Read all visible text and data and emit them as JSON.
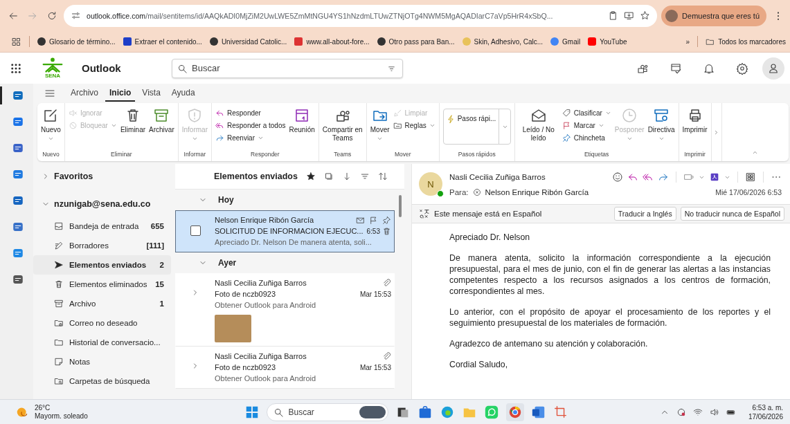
{
  "browser": {
    "url_host": "outlook.office.com",
    "url_path": "/mail/sentitems/id/AAQkADI0MjZiM2UwLWE5ZmMtNGU4YS1hNzdmLTUwZTNjOTg4NWM5MgAQADIarC7aVp5HrR4xSbQ...",
    "profile_chip": "Demuestra que eres tú",
    "bookmarks": [
      {
        "label": "Glosario de término..."
      },
      {
        "label": "Extraer el contenido..."
      },
      {
        "label": "Universidad Catolic..."
      },
      {
        "label": "www.all-about-fore..."
      },
      {
        "label": "Otro pass para Ban..."
      },
      {
        "label": "Skin, Adhesivo, Calc..."
      },
      {
        "label": "Gmail"
      },
      {
        "label": "YouTube"
      }
    ],
    "more": "»",
    "all_bookmarks": "Todos los marcadores"
  },
  "app": {
    "logo_text": "SENA",
    "name": "Outlook",
    "search_placeholder": "Buscar"
  },
  "rail": [
    {
      "selected": true
    },
    {
      "selected": false
    },
    {
      "selected": false
    },
    {
      "selected": false
    },
    {
      "selected": false
    },
    {
      "selected": false
    },
    {
      "selected": false
    },
    {
      "selected": false
    }
  ],
  "menu_tabs": [
    {
      "label": "Archivo",
      "selected": false
    },
    {
      "label": "Inicio",
      "selected": true
    },
    {
      "label": "Vista",
      "selected": false
    },
    {
      "label": "Ayuda",
      "selected": false
    }
  ],
  "ribbon": {
    "groups": [
      {
        "label": "Nuevo",
        "items": [
          {
            "kind": "large",
            "label": "Nuevo",
            "disabled": false,
            "dropdown": true
          }
        ]
      },
      {
        "label": "Eliminar",
        "items": [
          {
            "kind": "stack",
            "items": [
              {
                "label": "Ignorar",
                "disabled": true,
                "dropdown": false
              },
              {
                "label": "Bloquear",
                "disabled": true,
                "dropdown": true
              }
            ]
          },
          {
            "kind": "large",
            "label": "Eliminar",
            "disabled": false,
            "dropdown": false
          },
          {
            "kind": "large",
            "label": "Archivar",
            "disabled": false,
            "dropdown": false
          }
        ]
      },
      {
        "label": "Informar",
        "items": [
          {
            "kind": "large",
            "label": "Informar",
            "disabled": true,
            "dropdown": true
          }
        ]
      },
      {
        "label": "Responder",
        "items": [
          {
            "kind": "stack",
            "items": [
              {
                "label": "Responder",
                "disabled": false,
                "dropdown": false
              },
              {
                "label": "Responder a todos",
                "disabled": false,
                "dropdown": false
              },
              {
                "label": "Reenviar",
                "disabled": false,
                "dropdown": true
              }
            ]
          },
          {
            "kind": "large",
            "label": "Reunión",
            "disabled": false,
            "dropdown": false
          }
        ]
      },
      {
        "label": "Teams",
        "items": [
          {
            "kind": "large",
            "label": "Compartir en Teams",
            "disabled": false,
            "dropdown": false
          }
        ]
      },
      {
        "label": "Mover",
        "items": [
          {
            "kind": "large",
            "label": "Mover",
            "disabled": false,
            "dropdown": true
          },
          {
            "kind": "stack",
            "items": [
              {
                "label": "Limpiar",
                "disabled": true,
                "dropdown": false
              },
              {
                "label": "Reglas",
                "disabled": false,
                "dropdown": true
              }
            ]
          }
        ]
      },
      {
        "label": "Pasos rápidos",
        "items": [
          {
            "kind": "gallery",
            "label": "Pasos rápi...",
            "disabled": false,
            "dropdown": true
          }
        ]
      },
      {
        "label": "Etiquetas",
        "items": [
          {
            "kind": "large",
            "label": "Leído / No leído",
            "disabled": false,
            "dropdown": false
          },
          {
            "kind": "stack",
            "items": [
              {
                "label": "Clasificar",
                "disabled": false,
                "dropdown": true
              },
              {
                "label": "Marcar",
                "disabled": false,
                "dropdown": true
              },
              {
                "label": "Chincheta",
                "disabled": false,
                "dropdown": false
              }
            ]
          },
          {
            "kind": "large",
            "label": "Posponer",
            "disabled": true,
            "dropdown": true
          },
          {
            "kind": "large",
            "label": "Directiva",
            "disabled": false,
            "dropdown": true
          }
        ]
      },
      {
        "label": "Imprimir",
        "items": [
          {
            "kind": "large",
            "label": "Imprimir",
            "disabled": false,
            "dropdown": false
          }
        ]
      }
    ]
  },
  "folders": {
    "favorites": "Favoritos",
    "account": "nzunigab@sena.edu.co",
    "items": [
      {
        "label": "Bandeja de entrada",
        "count": "655",
        "selected": false
      },
      {
        "label": "Borradores",
        "count": "[111]",
        "selected": false
      },
      {
        "label": "Elementos enviados",
        "count": "2",
        "selected": true
      },
      {
        "label": "Elementos eliminados",
        "count": "15",
        "selected": false
      },
      {
        "label": "Archivo",
        "count": "1",
        "selected": false
      },
      {
        "label": "Correo no deseado",
        "selected": false
      },
      {
        "label": "Historial de conversacio...",
        "selected": false
      },
      {
        "label": "Notas",
        "selected": false
      },
      {
        "label": "Carpetas de búsqueda",
        "selected": false
      }
    ]
  },
  "message_list": {
    "title": "Elementos enviados",
    "groups": [
      {
        "label": "Hoy",
        "expanded": true,
        "messages": [
          {
            "sender": "Nelson Enrique Ribón García",
            "subject": "SOLICITUD DE INFORMACION EJECUC...",
            "time": "6:53",
            "preview": "Apreciado Dr. Nelson De manera atenta, soli...",
            "selected": true,
            "attachment": false,
            "photo": false
          }
        ]
      },
      {
        "label": "Ayer",
        "expanded": true,
        "messages": [
          {
            "sender": "Nasli Cecilia Zuñiga Barros",
            "subject": "Foto de nczb0923",
            "time": "Mar 15:53",
            "preview": "Obtener Outlook para Android",
            "selected": false,
            "attachment": true,
            "photo": true
          },
          {
            "sender": "Nasli Cecilia Zuñiga Barros",
            "subject": "Foto de nczb0923",
            "time": "Mar 15:53",
            "preview": "Obtener Outlook para Android",
            "selected": false,
            "attachment": true,
            "photo": false
          }
        ]
      }
    ]
  },
  "reading": {
    "avatar_initial": "N",
    "sender": "Nasli Cecilia Zuñiga Barros",
    "to_label": "Para:",
    "recipient": "Nelson Enrique Ribón García",
    "date": "Mié 17/06/2026 6:53",
    "translate_note": "Este mensaje está en Español",
    "translate_buttons": [
      "Traducir a Inglés",
      "No traducir nunca de Español"
    ],
    "body": [
      "Apreciado Dr. Nelson",
      "De manera atenta, solicito la información correspondiente a la ejecución presupuestal, para el mes de junio, con el fin de generar las alertas a las instancias competentes respecto a los recursos asignados a los centros de formación, correspondientes al mes.",
      "Lo anterior, con el propósito de apoyar el procesamiento de los reportes y el seguimiento presupuestal de los materiales de formación.",
      "Agradezco de antemano su atención y colaboración.",
      "Cordial Saludo,"
    ]
  },
  "taskbar": {
    "temperature": "26°C",
    "condition": "Mayorm. soleado",
    "search_placeholder": "Buscar",
    "time": "6:53 a. m.",
    "date": "17/06/2026"
  }
}
